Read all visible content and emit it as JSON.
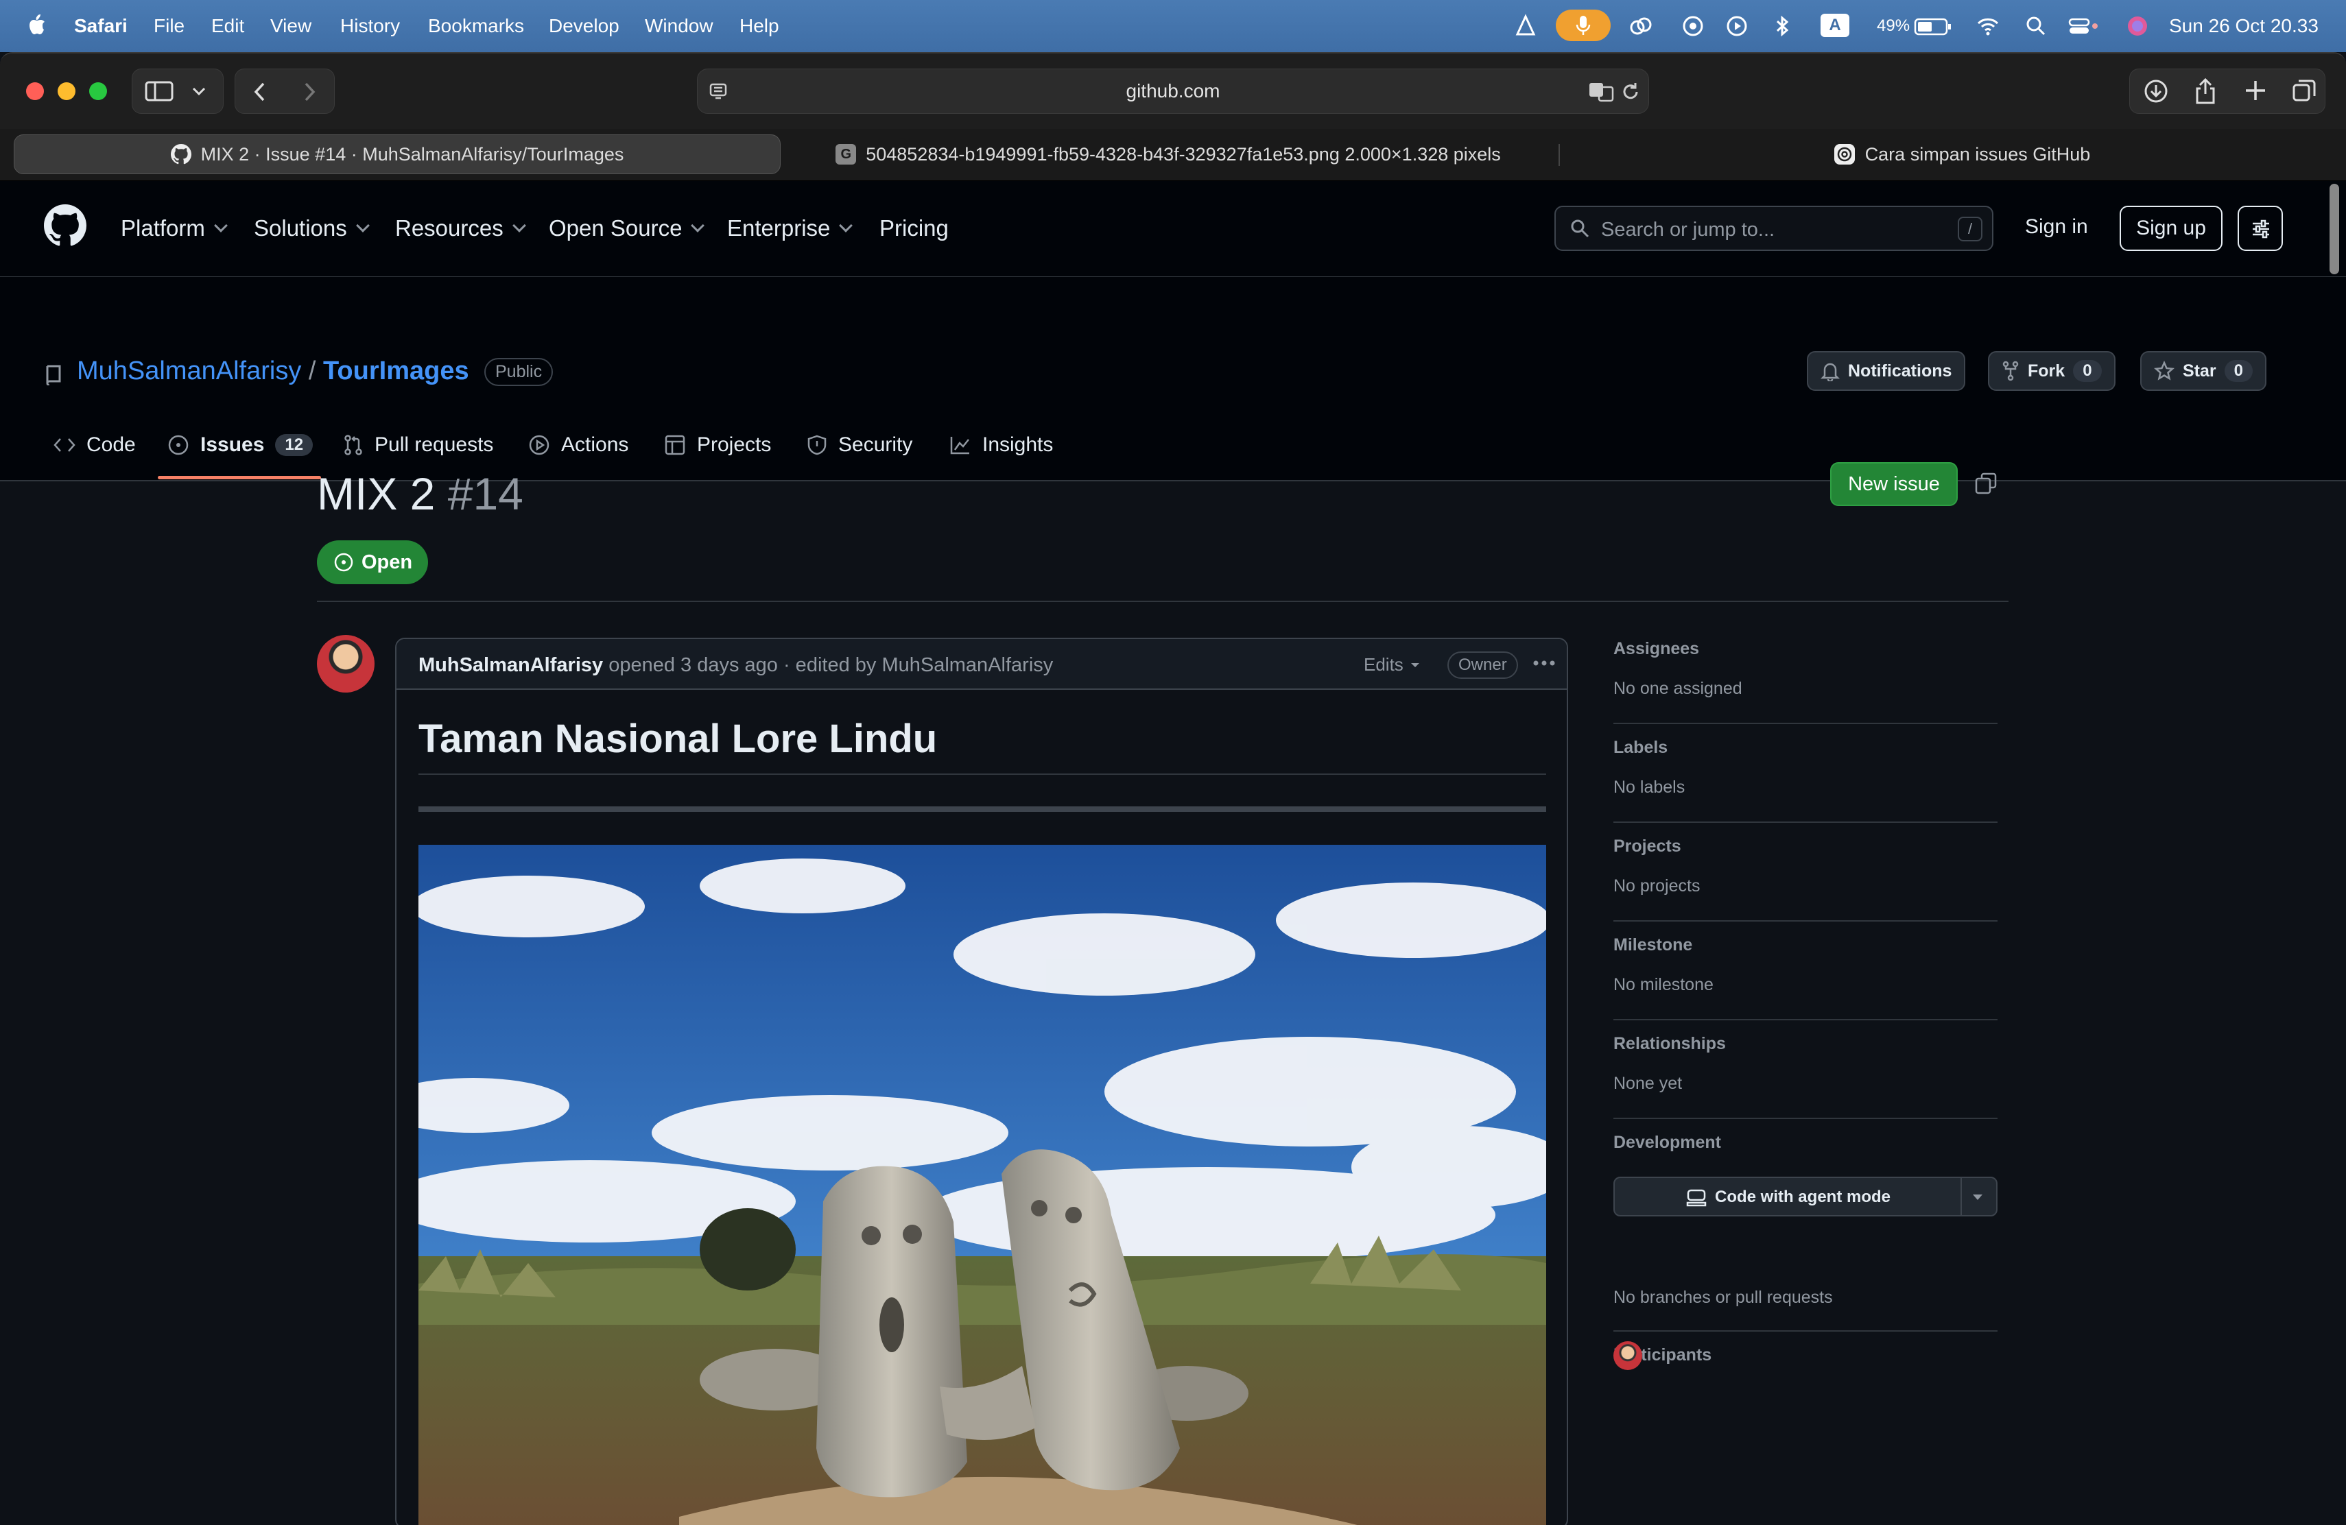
{
  "menubar": {
    "app": "Safari",
    "items": [
      "File",
      "Edit",
      "View",
      "History",
      "Bookmarks",
      "Develop",
      "Window",
      "Help"
    ],
    "battery": "49%",
    "clock": "Sun 26 Oct  20.33",
    "input_source": "A"
  },
  "browser": {
    "url": "github.com",
    "tabs": [
      {
        "label": "MIX 2 · Issue #14 · MuhSalmanAlfarisy/TourImages",
        "active": true
      },
      {
        "label": "504852834-b1949991-fb59-4328-b43f-329327fa1e53.png 2.000×1.328 pixels",
        "active": false
      },
      {
        "label": "Cara simpan issues GitHub",
        "active": false
      }
    ]
  },
  "github_header": {
    "nav": [
      "Platform",
      "Solutions",
      "Resources",
      "Open Source",
      "Enterprise",
      "Pricing"
    ],
    "search_placeholder": "Search or jump to...",
    "search_shortcut": "/",
    "sign_in": "Sign in",
    "sign_up": "Sign up"
  },
  "repo": {
    "owner": "MuhSalmanAlfarisy",
    "separator": "/",
    "name": "TourImages",
    "visibility": "Public",
    "notifications": "Notifications",
    "fork_label": "Fork",
    "fork_count": "0",
    "star_label": "Star",
    "star_count": "0",
    "tabs": {
      "code": "Code",
      "issues": "Issues",
      "issues_count": "12",
      "pulls": "Pull requests",
      "actions": "Actions",
      "projects": "Projects",
      "security": "Security",
      "insights": "Insights"
    }
  },
  "issue": {
    "title": "MIX 2",
    "number": "#14",
    "new_issue": "New issue",
    "state": "Open",
    "comment": {
      "author": "MuhSalmanAlfarisy",
      "meta": "opened 3 days ago · edited by MuhSalmanAlfarisy",
      "edits": "Edits",
      "role": "Owner",
      "heading": "Taman Nasional Lore Lindu"
    }
  },
  "sidebar": {
    "assignees_h": "Assignees",
    "assignees_v": "No one assigned",
    "labels_h": "Labels",
    "labels_v": "No labels",
    "projects_h": "Projects",
    "projects_v": "No projects",
    "milestone_h": "Milestone",
    "milestone_v": "No milestone",
    "relationships_h": "Relationships",
    "relationships_v": "None yet",
    "development_h": "Development",
    "agent_button": "Code with agent mode",
    "development_v": "No branches or pull requests",
    "participants_h": "Participants"
  },
  "colors": {
    "accent_green": "#238636",
    "link_blue": "#4493f8",
    "tab_underline": "#f78166",
    "background": "#0d1117"
  }
}
